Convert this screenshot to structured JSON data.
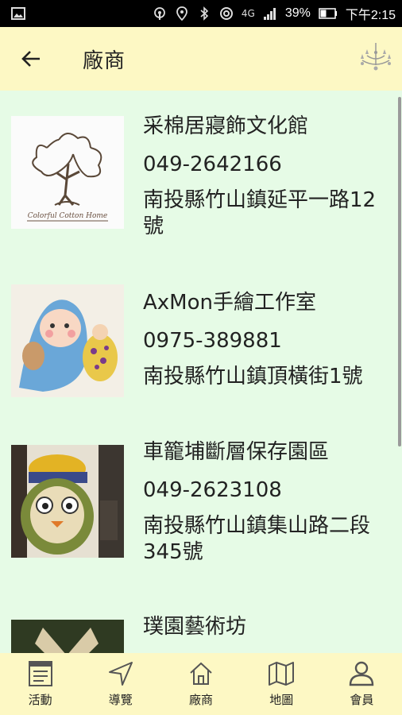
{
  "status": {
    "battery": "39%",
    "time": "下午2:15",
    "network": "4G"
  },
  "header": {
    "title": "廠商"
  },
  "colors": {
    "background": "#e6fbe6",
    "bar": "#fdf8c4"
  },
  "vendors": [
    {
      "name": "采棉居寢飾文化館",
      "phone": "049-2642166",
      "address": "南投縣竹山鎮延平一路12號",
      "logo_text": "Colorful Cotton Home"
    },
    {
      "name": "AxMon手繪工作室",
      "phone": "0975-389881",
      "address": "南投縣竹山鎮頂橫街1號"
    },
    {
      "name": "車籠埔斷層保存園區",
      "phone": "049-2623108",
      "address": "南投縣竹山鎮集山路二段345號"
    },
    {
      "name": "璞園藝術坊",
      "phone": "",
      "address": ""
    }
  ],
  "tabs": [
    {
      "label": "活動",
      "icon": "list-icon"
    },
    {
      "label": "導覽",
      "icon": "navigation-icon"
    },
    {
      "label": "廠商",
      "icon": "home-icon"
    },
    {
      "label": "地圖",
      "icon": "map-icon"
    },
    {
      "label": "會員",
      "icon": "person-icon"
    }
  ]
}
